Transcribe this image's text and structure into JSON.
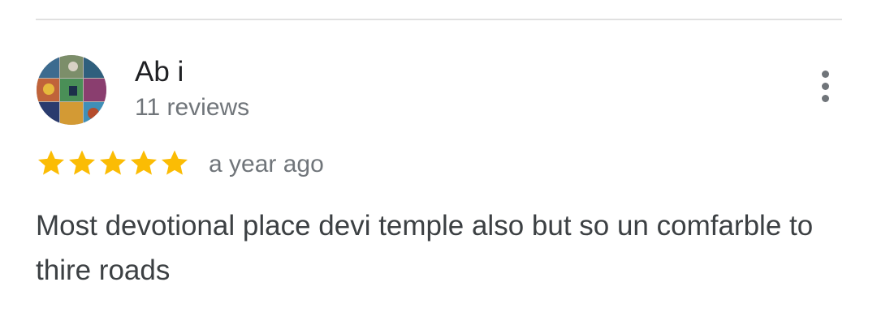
{
  "review": {
    "author_name": "Ab i",
    "review_count": "11 reviews",
    "rating": 5,
    "rating_max": 5,
    "date": "a year ago",
    "text": "Most devotional place devi temple also but so un comfarble to thire roads"
  },
  "icons": {
    "more": "more-vert-icon",
    "star": "star-icon",
    "avatar": "profile-photo"
  },
  "colors": {
    "star": "#fbbc04",
    "name": "#202124",
    "secondary": "#70757a",
    "body": "#3c4043",
    "divider": "#e0e0e0"
  }
}
